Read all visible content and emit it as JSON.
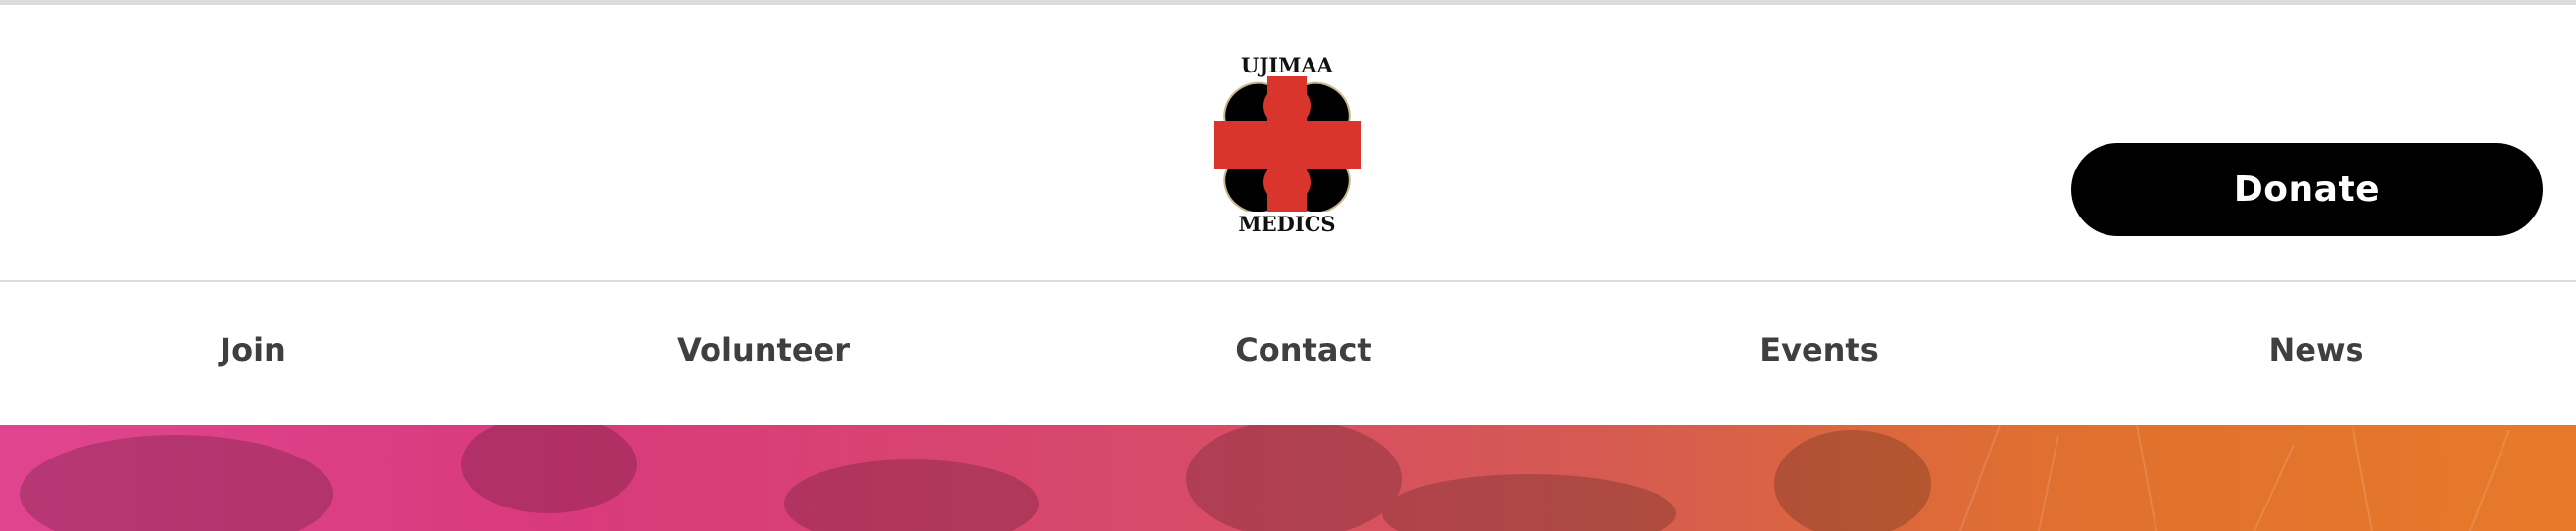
{
  "header": {
    "logo": {
      "top_text": "UJIMAA",
      "bottom_text": "MEDICS",
      "colors": {
        "red": "#d9352c",
        "black": "#000000",
        "outline": "#c9b98a"
      }
    },
    "donate_label": "Donate"
  },
  "nav": {
    "items": [
      {
        "label": "Join"
      },
      {
        "label": "Volunteer"
      },
      {
        "label": "Contact"
      },
      {
        "label": "Events"
      },
      {
        "label": "News"
      }
    ]
  },
  "theme": {
    "hero_gradient_start": "#e0458f",
    "hero_gradient_end": "#e77a2a",
    "nav_text_color": "#3f3f3f",
    "button_bg": "#000000",
    "button_text": "#ffffff"
  }
}
